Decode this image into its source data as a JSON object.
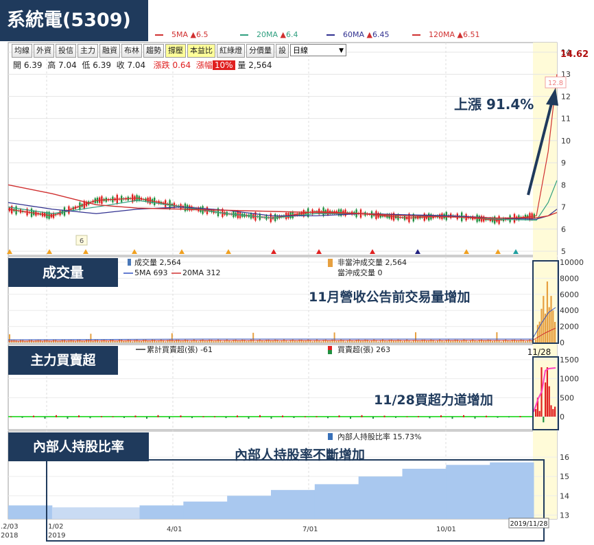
{
  "stock_title": "系統電(5309)",
  "toolbar": {
    "buttons": [
      "均線",
      "外資",
      "投信",
      "主力",
      "融資",
      "布林",
      "趨勢",
      "撐壓",
      "本益比",
      "紅綠燈",
      "分價量",
      "設"
    ],
    "active": [
      "撐壓",
      "本益比"
    ],
    "period_select": "日線"
  },
  "ohlc": {
    "open_label": "開",
    "open": "6.39",
    "high_label": "高",
    "high": "7.04",
    "low_label": "低",
    "low": "6.39",
    "close_label": "收",
    "close": "7.04",
    "change_label": "漲跌",
    "change": "0.64",
    "pct_label": "漲幅",
    "pct": "10%",
    "vol_label": "量",
    "volume": "2,564"
  },
  "ma_legend": [
    {
      "label": "5MA",
      "arrow": "▲",
      "value": "6.5",
      "color": "#d03030"
    },
    {
      "label": "20MA",
      "arrow": "▲",
      "value": "6.4",
      "color": "#30a080"
    },
    {
      "label": "60MA",
      "arrow": "▲",
      "value": "6.45",
      "color": "#303090"
    },
    {
      "label": "120MA",
      "arrow": "▲",
      "value": "6.51",
      "color": "#d03030"
    }
  ],
  "badges": {
    "volume": "成交量",
    "institutional": "主力買賣超",
    "insider": "內部人持股比率"
  },
  "annotations": {
    "rise": "上漲 91.4%",
    "volume": "11月營收公告前交易量增加",
    "institutional": "11/28買超力道增加",
    "insider": "內部人持股率不斷增加"
  },
  "price_panel": {
    "last_price": "14.62",
    "peak_label": "12.8",
    "low_marker": "6"
  },
  "volume_panel": {
    "legend_vol": "成交量 2,564",
    "legend_5ma": "5MA 693",
    "legend_20ma": "20MA 312",
    "legend_nonday": "非當沖成交量 2,564",
    "legend_dayt": "當沖成交量 0",
    "date_marker": "11/28"
  },
  "inst_panel": {
    "legend_cum": "累計買賣超(張) -61",
    "legend_daily": "買賣超(張) 263"
  },
  "insider_panel": {
    "legend": "內部人持股比率 15.73%",
    "date_box": "2019/11/28"
  },
  "x_axis": {
    "labels": [
      {
        "line1": ".2/03",
        "line2": "2018"
      },
      {
        "line1": "1/02",
        "line2": "2019"
      },
      {
        "line1": "4/01",
        "line2": ""
      },
      {
        "line1": "7/01",
        "line2": ""
      },
      {
        "line1": "10/01",
        "line2": ""
      }
    ]
  },
  "colors": {
    "badge_bg": "#1f3a5c",
    "up": "#e02020",
    "down": "#209040",
    "volume_bar": "#e6a040",
    "insider_fill": "#a9c8ef",
    "highlight": "#fffbd8"
  },
  "chart_data": [
    {
      "type": "line",
      "title": "",
      "ylim": [
        5,
        14.62
      ],
      "yticks": [
        5,
        6,
        7,
        8,
        9,
        10,
        11,
        12,
        13,
        14
      ],
      "series": [
        {
          "name": "5MA",
          "x": [
            "2018-12-03",
            "2019-01-02",
            "2019-02-01",
            "2019-03-01",
            "2019-04-01",
            "2019-05-01",
            "2019-06-01",
            "2019-07-01",
            "2019-08-01",
            "2019-09-01",
            "2019-10-01",
            "2019-11-01",
            "2019-11-28",
            "2019-12-06",
            "2019-12-12"
          ],
          "values": [
            6.9,
            6.6,
            7.3,
            7.4,
            7.0,
            6.7,
            6.5,
            6.8,
            6.7,
            6.5,
            6.6,
            6.4,
            6.6,
            9.5,
            13.0
          ]
        },
        {
          "name": "20MA",
          "x": [
            "2018-12-03",
            "2019-01-02",
            "2019-02-01",
            "2019-03-01",
            "2019-04-01",
            "2019-05-01",
            "2019-06-01",
            "2019-07-01",
            "2019-08-01",
            "2019-09-01",
            "2019-10-01",
            "2019-11-01",
            "2019-11-28",
            "2019-12-06",
            "2019-12-12"
          ],
          "values": [
            7.0,
            6.7,
            7.0,
            7.3,
            7.0,
            6.7,
            6.5,
            6.7,
            6.7,
            6.6,
            6.6,
            6.45,
            6.4,
            7.2,
            8.2
          ]
        },
        {
          "name": "60MA",
          "x": [
            "2018-12-03",
            "2019-01-02",
            "2019-02-01",
            "2019-03-01",
            "2019-04-01",
            "2019-05-01",
            "2019-06-01",
            "2019-07-01",
            "2019-08-01",
            "2019-09-01",
            "2019-10-01",
            "2019-11-01",
            "2019-11-28",
            "2019-12-06",
            "2019-12-12"
          ],
          "values": [
            7.2,
            6.9,
            6.7,
            6.9,
            7.0,
            6.85,
            6.6,
            6.6,
            6.7,
            6.65,
            6.6,
            6.5,
            6.45,
            6.6,
            6.9
          ]
        },
        {
          "name": "120MA",
          "x": [
            "2018-12-03",
            "2019-01-02",
            "2019-02-01",
            "2019-03-01",
            "2019-04-01",
            "2019-05-01",
            "2019-06-01",
            "2019-07-01",
            "2019-08-01",
            "2019-09-01",
            "2019-10-01",
            "2019-11-01",
            "2019-11-28",
            "2019-12-06",
            "2019-12-12"
          ],
          "values": [
            8.0,
            7.6,
            7.1,
            6.95,
            6.9,
            6.85,
            6.8,
            6.75,
            6.7,
            6.6,
            6.55,
            6.5,
            6.51,
            6.6,
            6.75
          ]
        }
      ]
    },
    {
      "type": "bar",
      "title": "",
      "ylim": [
        0,
        10000
      ],
      "yticks": [
        0,
        2000,
        4000,
        6000,
        8000,
        10000
      ],
      "x": [
        "11/28",
        "11/29",
        "12/02",
        "12/03",
        "12/04",
        "12/05",
        "12/06",
        "12/09",
        "12/10",
        "12/11",
        "12/12"
      ],
      "values": [
        400,
        2200,
        2600,
        4200,
        5800,
        3600,
        7600,
        4400,
        5800,
        4000,
        2564
      ]
    },
    {
      "type": "bar",
      "title": "",
      "ylim": [
        -200,
        1500
      ],
      "yticks": [
        0,
        500,
        1000,
        1500
      ],
      "x": [
        "11/28",
        "11/29",
        "12/02",
        "12/03",
        "12/04",
        "12/05",
        "12/06",
        "12/09",
        "12/10",
        "12/11",
        "12/12"
      ],
      "values": [
        200,
        500,
        150,
        1300,
        -150,
        900,
        1300,
        800,
        300,
        200,
        263
      ]
    },
    {
      "type": "area",
      "title": "",
      "ylim": [
        12.8,
        16.5
      ],
      "yticks": [
        13,
        14,
        15,
        16
      ],
      "x": [
        "2018-12",
        "2019-01",
        "2019-02",
        "2019-03",
        "2019-04",
        "2019-05",
        "2019-06",
        "2019-07",
        "2019-08",
        "2019-09",
        "2019-10",
        "2019-11"
      ],
      "values": [
        13.5,
        13.4,
        13.4,
        13.5,
        13.7,
        14.0,
        14.3,
        14.6,
        15.0,
        15.4,
        15.6,
        15.73
      ]
    }
  ]
}
